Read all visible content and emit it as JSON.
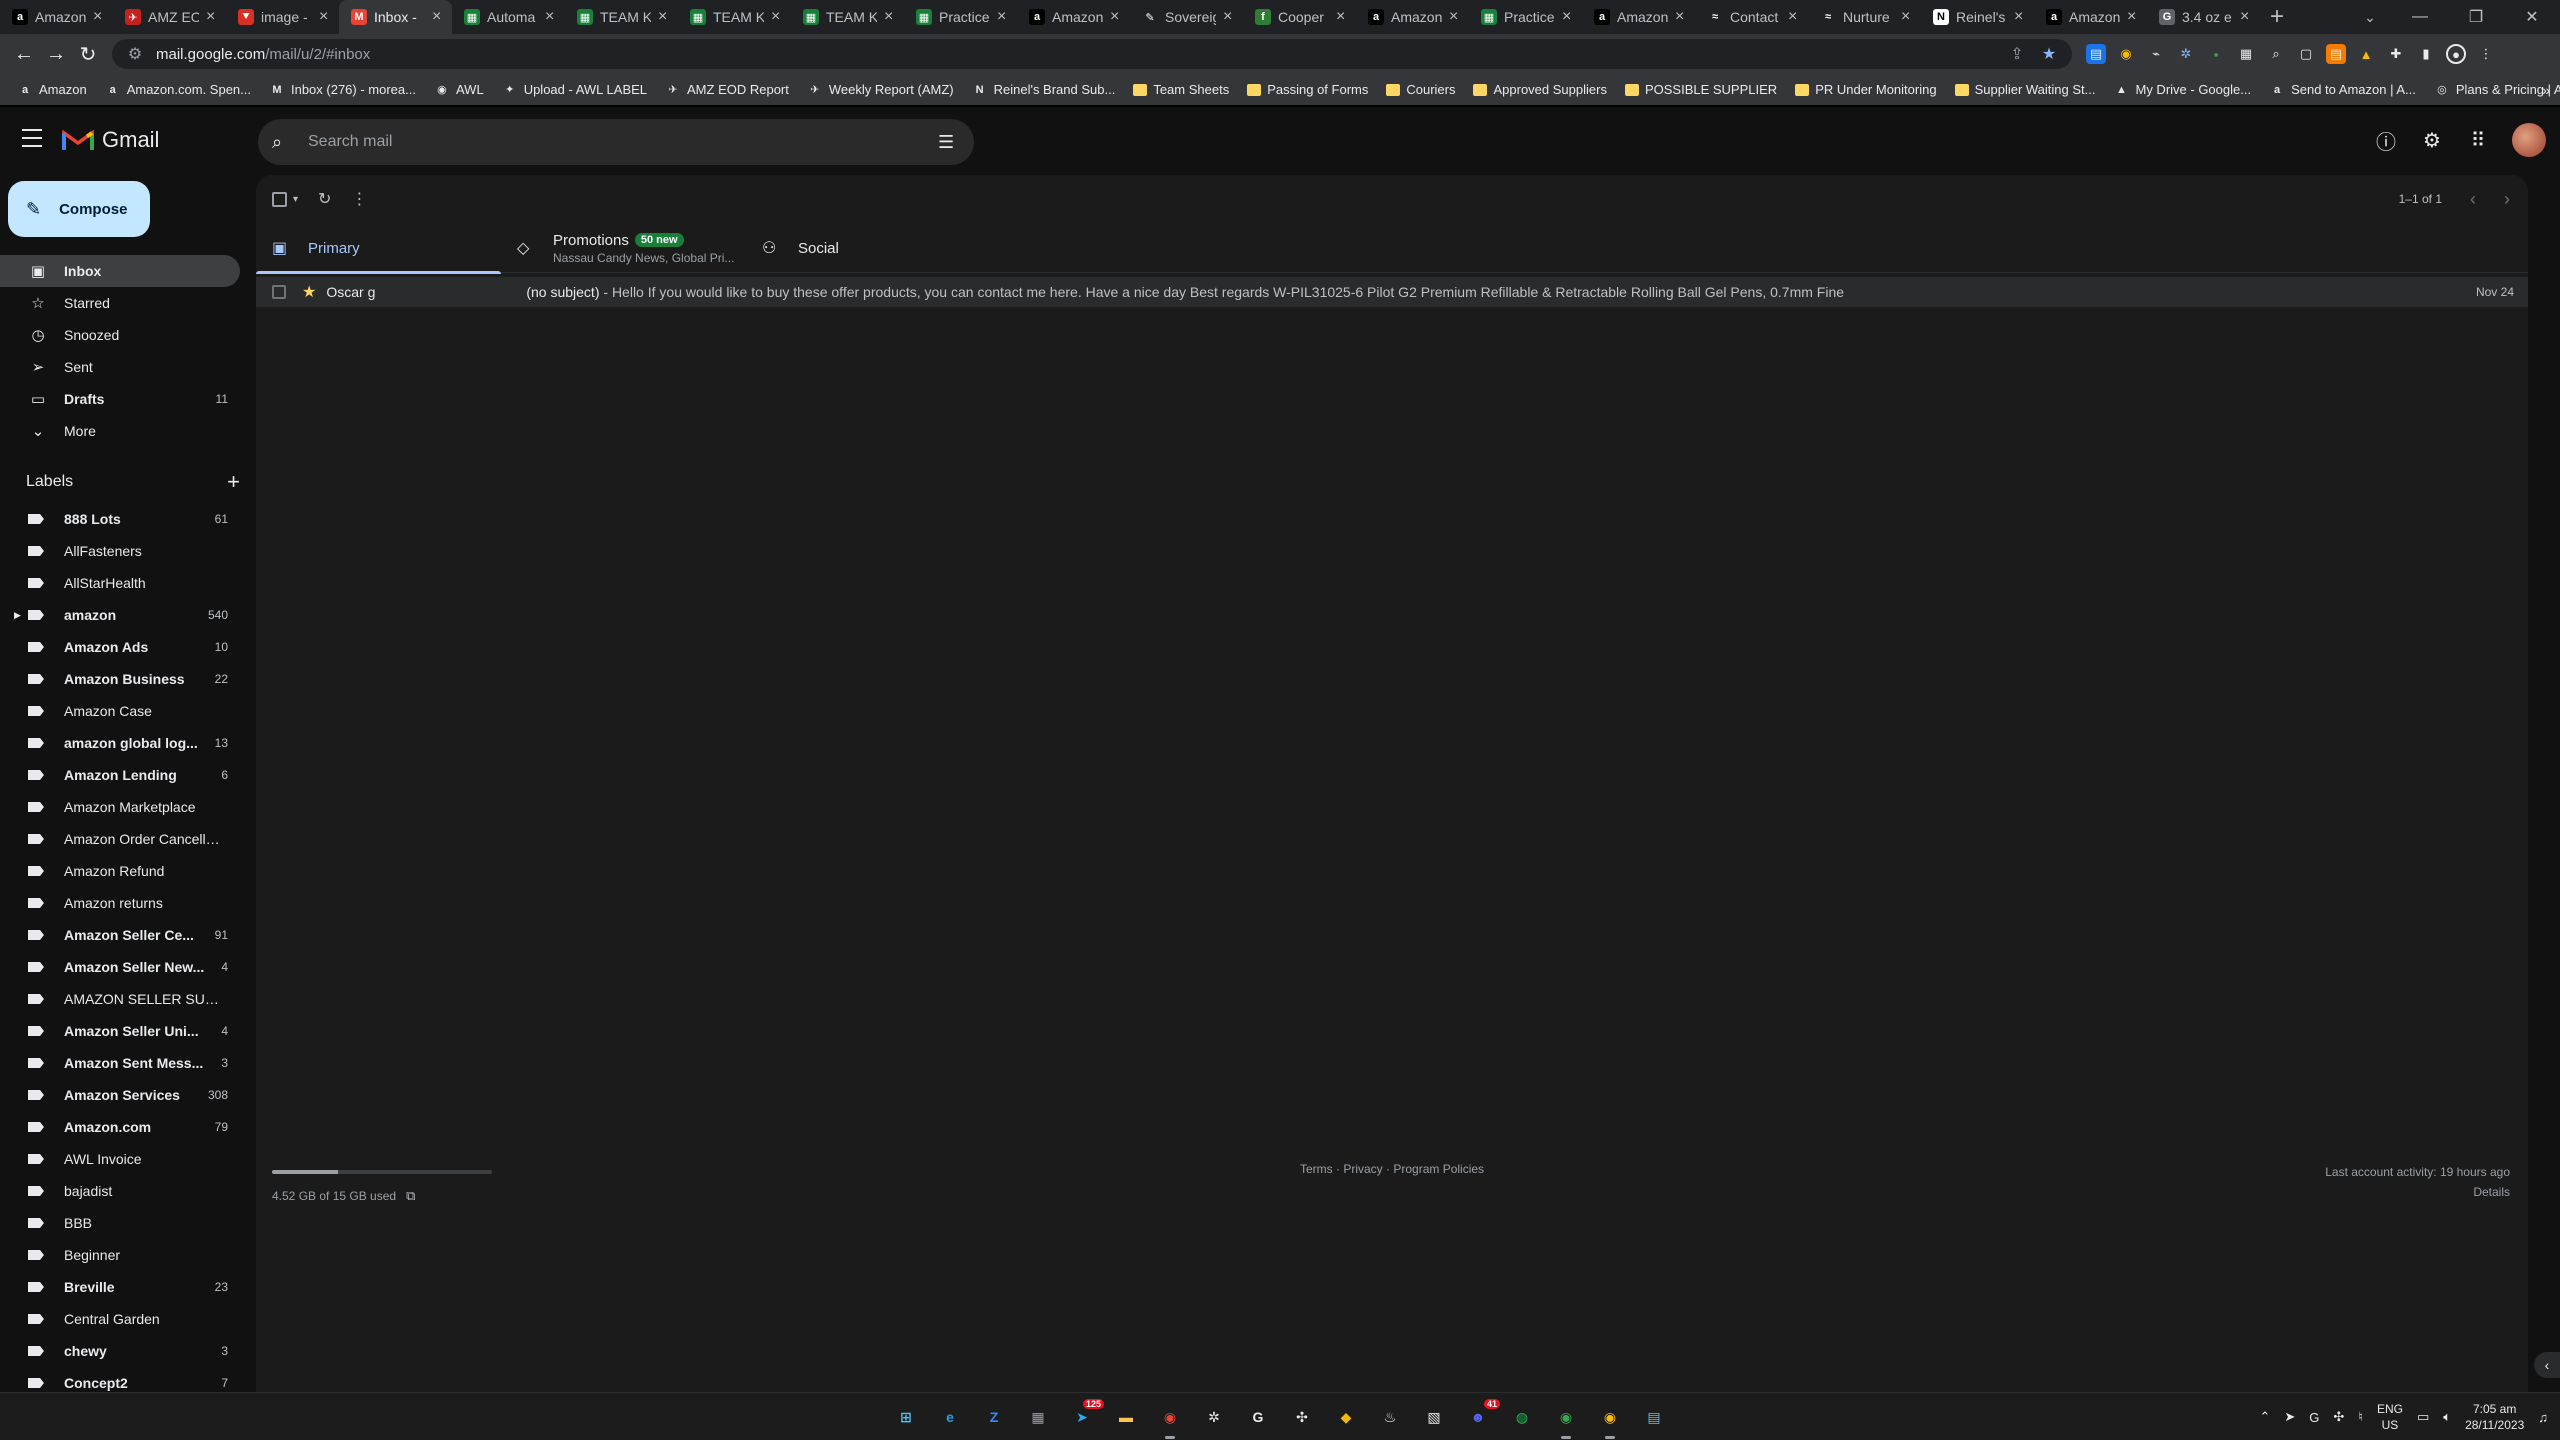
{
  "browser": {
    "tabs": [
      {
        "title": "Amazon",
        "favicon": "a",
        "color": "#000000",
        "active": false
      },
      {
        "title": "AMZ EO",
        "favicon": "✈",
        "color": "#c5221f",
        "active": false
      },
      {
        "title": "image -",
        "favicon": "⯆",
        "color": "#d93025",
        "active": false
      },
      {
        "title": "Inbox -",
        "favicon": "M",
        "color": "#ea4335",
        "active": true
      },
      {
        "title": "Automa",
        "favicon": "▦",
        "color": "#188038",
        "active": false
      },
      {
        "title": "TEAM K",
        "favicon": "▦",
        "color": "#188038",
        "active": false
      },
      {
        "title": "TEAM K",
        "favicon": "▦",
        "color": "#188038",
        "active": false
      },
      {
        "title": "TEAM K",
        "favicon": "▦",
        "color": "#188038",
        "active": false
      },
      {
        "title": "Practice",
        "favicon": "▦",
        "color": "#188038",
        "active": false
      },
      {
        "title": "Amazon",
        "favicon": "a",
        "color": "#000000",
        "active": false
      },
      {
        "title": "Sovereig",
        "favicon": "✎",
        "color": "#202124",
        "active": false
      },
      {
        "title": "Cooper",
        "favicon": "f",
        "color": "#2e7d32",
        "active": false
      },
      {
        "title": "Amazon",
        "favicon": "a",
        "color": "#000000",
        "active": false
      },
      {
        "title": "Practice",
        "favicon": "▦",
        "color": "#188038",
        "active": false
      },
      {
        "title": "Amazon",
        "favicon": "a",
        "color": "#000000",
        "active": false
      },
      {
        "title": "Contact",
        "favicon": "≈",
        "color": "#202124",
        "active": false
      },
      {
        "title": "Nurture",
        "favicon": "≈",
        "color": "#202124",
        "active": false
      },
      {
        "title": "Reinel's",
        "favicon": "N",
        "color": "#ffffff",
        "active": false
      },
      {
        "title": "Amazon",
        "favicon": "a",
        "color": "#000000",
        "active": false
      },
      {
        "title": "3.4 oz e",
        "favicon": "G",
        "color": "#5f6368",
        "active": false
      }
    ],
    "url_host": "mail.google.com",
    "url_path": "/mail/u/2/#inbox",
    "bookmarks": [
      {
        "label": "Amazon",
        "icon": "a",
        "type": "site"
      },
      {
        "label": "Amazon.com. Spen...",
        "icon": "a",
        "type": "site"
      },
      {
        "label": "Inbox (276) - morea...",
        "icon": "M",
        "type": "site"
      },
      {
        "label": "AWL",
        "icon": "◉",
        "type": "site"
      },
      {
        "label": "Upload - AWL LABEL",
        "icon": "✦",
        "type": "site"
      },
      {
        "label": "AMZ EOD Report",
        "icon": "✈",
        "type": "site"
      },
      {
        "label": "Weekly Report (AMZ)",
        "icon": "✈",
        "type": "site"
      },
      {
        "label": "Reinel's Brand Sub...",
        "icon": "N",
        "type": "site"
      },
      {
        "label": "Team Sheets",
        "icon": "",
        "type": "folder"
      },
      {
        "label": "Passing of Forms",
        "icon": "",
        "type": "folder"
      },
      {
        "label": "Couriers",
        "icon": "",
        "type": "folder"
      },
      {
        "label": "Approved Suppliers",
        "icon": "",
        "type": "folder"
      },
      {
        "label": "POSSIBLE SUPPLIER",
        "icon": "",
        "type": "folder"
      },
      {
        "label": "PR Under Monitoring",
        "icon": "",
        "type": "folder"
      },
      {
        "label": "Supplier Waiting St...",
        "icon": "",
        "type": "folder"
      },
      {
        "label": "My Drive - Google...",
        "icon": "▲",
        "type": "site"
      },
      {
        "label": "Send to Amazon | A...",
        "icon": "a",
        "type": "site"
      },
      {
        "label": "Plans & Pricing | A...",
        "icon": "◎",
        "type": "site"
      }
    ]
  },
  "gmail": {
    "brand": "Gmail",
    "search_placeholder": "Search mail",
    "compose_label": "Compose",
    "nav": [
      {
        "label": "Inbox",
        "icon": "inbox-icon",
        "glyph": "▣",
        "count": "",
        "active": true
      },
      {
        "label": "Starred",
        "icon": "star-icon",
        "glyph": "☆",
        "count": "",
        "active": false
      },
      {
        "label": "Snoozed",
        "icon": "clock-icon",
        "glyph": "◷",
        "count": "",
        "active": false
      },
      {
        "label": "Sent",
        "icon": "send-icon",
        "glyph": "➢",
        "count": "",
        "active": false
      },
      {
        "label": "Drafts",
        "icon": "draft-icon",
        "glyph": "▭",
        "count": "11",
        "active": false,
        "bold": true
      },
      {
        "label": "More",
        "icon": "chevron-down-icon",
        "glyph": "⌄",
        "count": "",
        "active": false
      }
    ],
    "labels_title": "Labels",
    "labels": [
      {
        "name": "888 Lots",
        "count": "61",
        "bold": true
      },
      {
        "name": "AllFasteners",
        "count": "",
        "bold": false
      },
      {
        "name": "AllStarHealth",
        "count": "",
        "bold": false
      },
      {
        "name": "amazon",
        "count": "540",
        "bold": true,
        "expandable": true
      },
      {
        "name": "Amazon Ads",
        "count": "10",
        "bold": true
      },
      {
        "name": "Amazon Business",
        "count": "22",
        "bold": true
      },
      {
        "name": "Amazon Case",
        "count": "",
        "bold": false
      },
      {
        "name": "amazon global log...",
        "count": "13",
        "bold": true
      },
      {
        "name": "Amazon Lending",
        "count": "6",
        "bold": true
      },
      {
        "name": "Amazon Marketplace",
        "count": "",
        "bold": false
      },
      {
        "name": "Amazon Order Cancella...",
        "count": "",
        "bold": false
      },
      {
        "name": "Amazon Refund",
        "count": "",
        "bold": false
      },
      {
        "name": "Amazon returns",
        "count": "",
        "bold": false
      },
      {
        "name": "Amazon Seller Ce...",
        "count": "91",
        "bold": true
      },
      {
        "name": "Amazon Seller New...",
        "count": "4",
        "bold": true
      },
      {
        "name": "AMAZON SELLER SUPP...",
        "count": "",
        "bold": false
      },
      {
        "name": "Amazon Seller Uni...",
        "count": "4",
        "bold": true
      },
      {
        "name": "Amazon Sent Mess...",
        "count": "3",
        "bold": true
      },
      {
        "name": "Amazon Services",
        "count": "308",
        "bold": true
      },
      {
        "name": "Amazon.com",
        "count": "79",
        "bold": true
      },
      {
        "name": "AWL Invoice",
        "count": "",
        "bold": false
      },
      {
        "name": "bajadist",
        "count": "",
        "bold": false
      },
      {
        "name": "BBB",
        "count": "",
        "bold": false
      },
      {
        "name": "Beginner",
        "count": "",
        "bold": false
      },
      {
        "name": "Breville",
        "count": "23",
        "bold": true
      },
      {
        "name": "Central Garden",
        "count": "",
        "bold": false
      },
      {
        "name": "chewy",
        "count": "3",
        "bold": true
      },
      {
        "name": "Concept2",
        "count": "7",
        "bold": true
      }
    ],
    "pager_text": "1–1 of 1",
    "tabs": [
      {
        "label": "Primary",
        "icon": "inbox-icon",
        "glyph": "▣",
        "badge": "",
        "sub": "",
        "active": true
      },
      {
        "label": "Promotions",
        "icon": "tag-icon",
        "glyph": "◇",
        "badge": "50 new",
        "sub": "Nassau Candy News, Global Pri...",
        "active": false
      },
      {
        "label": "Social",
        "icon": "people-icon",
        "glyph": "⚇",
        "badge": "",
        "sub": "",
        "active": false
      }
    ],
    "emails": [
      {
        "sender": "Oscar g",
        "subject": "(no subject)",
        "snippet": " - Hello If you would like to buy these offer products, you can contact me here. Have a nice day Best regards W-PIL31025-6 Pilot G2 Premium Refillable & Retractable Rolling Ball Gel Pens, 0.7mm Fine",
        "date": "Nov 24",
        "starred": true
      }
    ],
    "footer": {
      "storage_text": "4.52 GB of 15 GB used",
      "storage_fraction": 0.301,
      "terms": "Terms",
      "privacy": "Privacy",
      "policies": "Program Policies",
      "sep": " · ",
      "activity": "Last account activity: 19 hours ago",
      "details": "Details"
    }
  },
  "taskbar": {
    "apps": [
      {
        "name": "start",
        "glyph": "⊞",
        "color": "#4cc2ff"
      },
      {
        "name": "edge",
        "glyph": "e",
        "color": "#1fa0e3"
      },
      {
        "name": "zoom",
        "glyph": "Z",
        "color": "#2d8cff"
      },
      {
        "name": "calculator",
        "glyph": "▦",
        "color": "#9aa0a6"
      },
      {
        "name": "telegram",
        "glyph": "➤",
        "color": "#2aabee",
        "badge": "125"
      },
      {
        "name": "explorer",
        "glyph": "▬",
        "color": "#f9c74f"
      },
      {
        "name": "chrome",
        "glyph": "◉",
        "color": "#ea4335"
      },
      {
        "name": "settings-app",
        "glyph": "✲",
        "color": "#e8eaed"
      },
      {
        "name": "app-g",
        "glyph": "G",
        "color": "#e8eaed"
      },
      {
        "name": "app-flower",
        "glyph": "✣",
        "color": "#e8eaed"
      },
      {
        "name": "binance",
        "glyph": "◆",
        "color": "#f0b90b"
      },
      {
        "name": "steam",
        "glyph": "♨",
        "color": "#e8eaed"
      },
      {
        "name": "app-box",
        "glyph": "▧",
        "color": "#e8eaed"
      },
      {
        "name": "discord",
        "glyph": "☻",
        "color": "#5865f2",
        "badge": "41"
      },
      {
        "name": "spotify",
        "glyph": "◍",
        "color": "#1db954"
      },
      {
        "name": "chrome-profile",
        "glyph": "◉",
        "color": "#34a853"
      },
      {
        "name": "chrome-profile-2",
        "glyph": "◉",
        "color": "#fbbc04"
      },
      {
        "name": "notepad",
        "glyph": "▤",
        "color": "#4fc3f7"
      }
    ],
    "lang_top": "ENG",
    "lang_bottom": "US",
    "time": "7:05 am",
    "date": "28/11/2023"
  }
}
